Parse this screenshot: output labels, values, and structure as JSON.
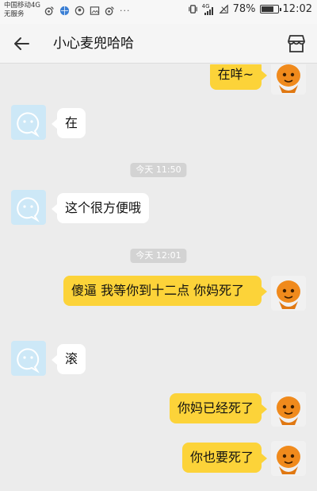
{
  "status_bar": {
    "carrier_line1": "中国移动4G",
    "carrier_line2": "无服务",
    "battery_percent": "78%",
    "battery_level": 0.78,
    "time": "12:02",
    "net_label": "4G"
  },
  "header": {
    "title": "小心麦兜哈哈"
  },
  "messages": [
    {
      "side": "right",
      "text": "在咩~"
    },
    {
      "side": "left",
      "text": "在"
    },
    {
      "side": "time",
      "text": "今天 11:50"
    },
    {
      "side": "left",
      "text": "这个很方便哦"
    },
    {
      "side": "time",
      "text": "今天 12:01"
    },
    {
      "side": "right",
      "text": "傻逼 我等你到十二点 你妈死了"
    },
    {
      "side": "left",
      "text": "滚"
    },
    {
      "side": "right",
      "text": "你妈已经死了"
    },
    {
      "side": "right",
      "text": "你也要死了"
    }
  ],
  "colors": {
    "my_bubble": "#fcd339",
    "their_bubble": "#ffffff",
    "chat_background": "#ececec",
    "their_avatar_bg": "#cde8f7",
    "my_avatar_face": "#f08a1c"
  }
}
